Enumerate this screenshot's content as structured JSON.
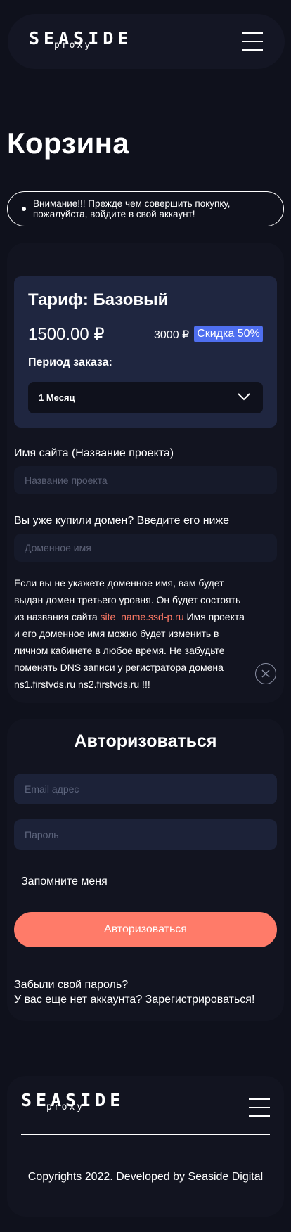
{
  "header": {
    "logo_main": "SEASIDE",
    "logo_sub": "proxy"
  },
  "page": {
    "title": "Корзина",
    "alert": "Внимание!!! Прежде чем совершить покупку, пожалуйста, войдите в свой аккаунт!"
  },
  "tariff": {
    "title": "Тариф: Базовый",
    "price": "1500.00 ₽",
    "old_price": "3000 ₽",
    "discount": "Скидка 50%",
    "period_label": "Период заказа:",
    "period_value": "1 Месяц"
  },
  "site_form": {
    "site_label": "Имя сайта (Название проекта)",
    "site_placeholder": "Название проекта",
    "domain_label": "Вы уже купили домен? Введите его ниже",
    "domain_placeholder": "Доменное имя",
    "info_before_link": "Если вы не укажете доменное имя, вам будет выдан домен третьего уровня. Он будет состоять из названия сайта ",
    "info_link": "site_name.ssd-p.ru",
    "info_after_link": " Имя проекта и его доменное имя можно будет изменить в личном кабинете в любое время. Не забудьте поменять DNS записи у регистратора домена ns1.firstvds.ru ns2.firstvds.ru !!!"
  },
  "auth": {
    "title": "Авторизоваться",
    "email_placeholder": "Email адрес",
    "password_placeholder": "Пароль",
    "remember_label": "Запомните меня",
    "submit_label": "Авторизоваться",
    "forgot_link": "Забыли свой пароль?",
    "register_link": "У вас еще нет аккаунта? Зарегистрироваться!"
  },
  "footer": {
    "logo_main": "SEASIDE",
    "logo_sub": "proxy",
    "copyright": "Copyrights 2022. Developed by Seaside Digital"
  },
  "colors": {
    "background": "#0f111c",
    "card": "#121420",
    "tariff_card": "#1f2640",
    "discount_badge": "#4f6ff0",
    "accent": "#ff7b69",
    "link": "#ff7a66"
  },
  "icons": [
    "menu-icon",
    "chevron-down-icon",
    "close-icon",
    "bullet-icon"
  ]
}
